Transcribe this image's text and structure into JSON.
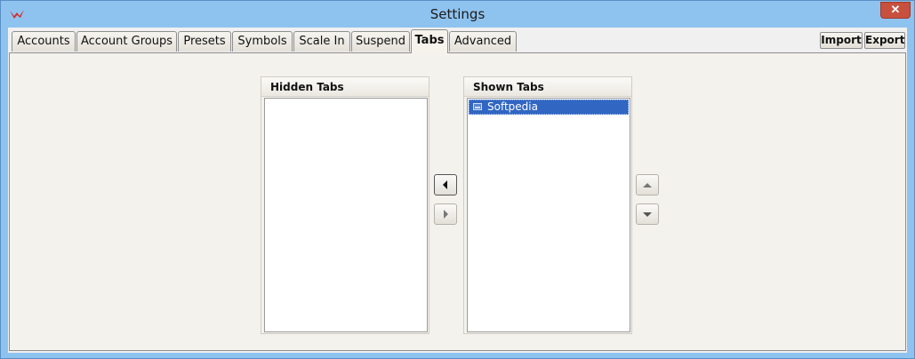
{
  "window": {
    "title": "Settings",
    "close_glyph": "✕",
    "app_icon": "app-logo-icon"
  },
  "tabs": [
    {
      "label": "Accounts",
      "active": false
    },
    {
      "label": "Account Groups",
      "active": false
    },
    {
      "label": "Presets",
      "active": false
    },
    {
      "label": "Symbols",
      "active": false
    },
    {
      "label": "Scale In",
      "active": false
    },
    {
      "label": "Suspend",
      "active": false
    },
    {
      "label": "Tabs",
      "active": true
    },
    {
      "label": "Advanced",
      "active": false
    }
  ],
  "header_buttons": {
    "import_label": "Import",
    "export_label": "Export"
  },
  "hidden_tabs": {
    "header": "Hidden Tabs",
    "items": []
  },
  "shown_tabs": {
    "header": "Shown Tabs",
    "items": [
      {
        "label": "Softpedia",
        "selected": true
      }
    ]
  },
  "controls": {
    "move_left_icon": "arrow-left-icon",
    "move_right_icon": "arrow-right-icon",
    "move_up_icon": "arrow-up-icon",
    "move_down_icon": "arrow-down-icon"
  },
  "colors": {
    "selection": "#3166c2",
    "titlebar": "#8fc3ef",
    "close_button": "#c7503f"
  }
}
